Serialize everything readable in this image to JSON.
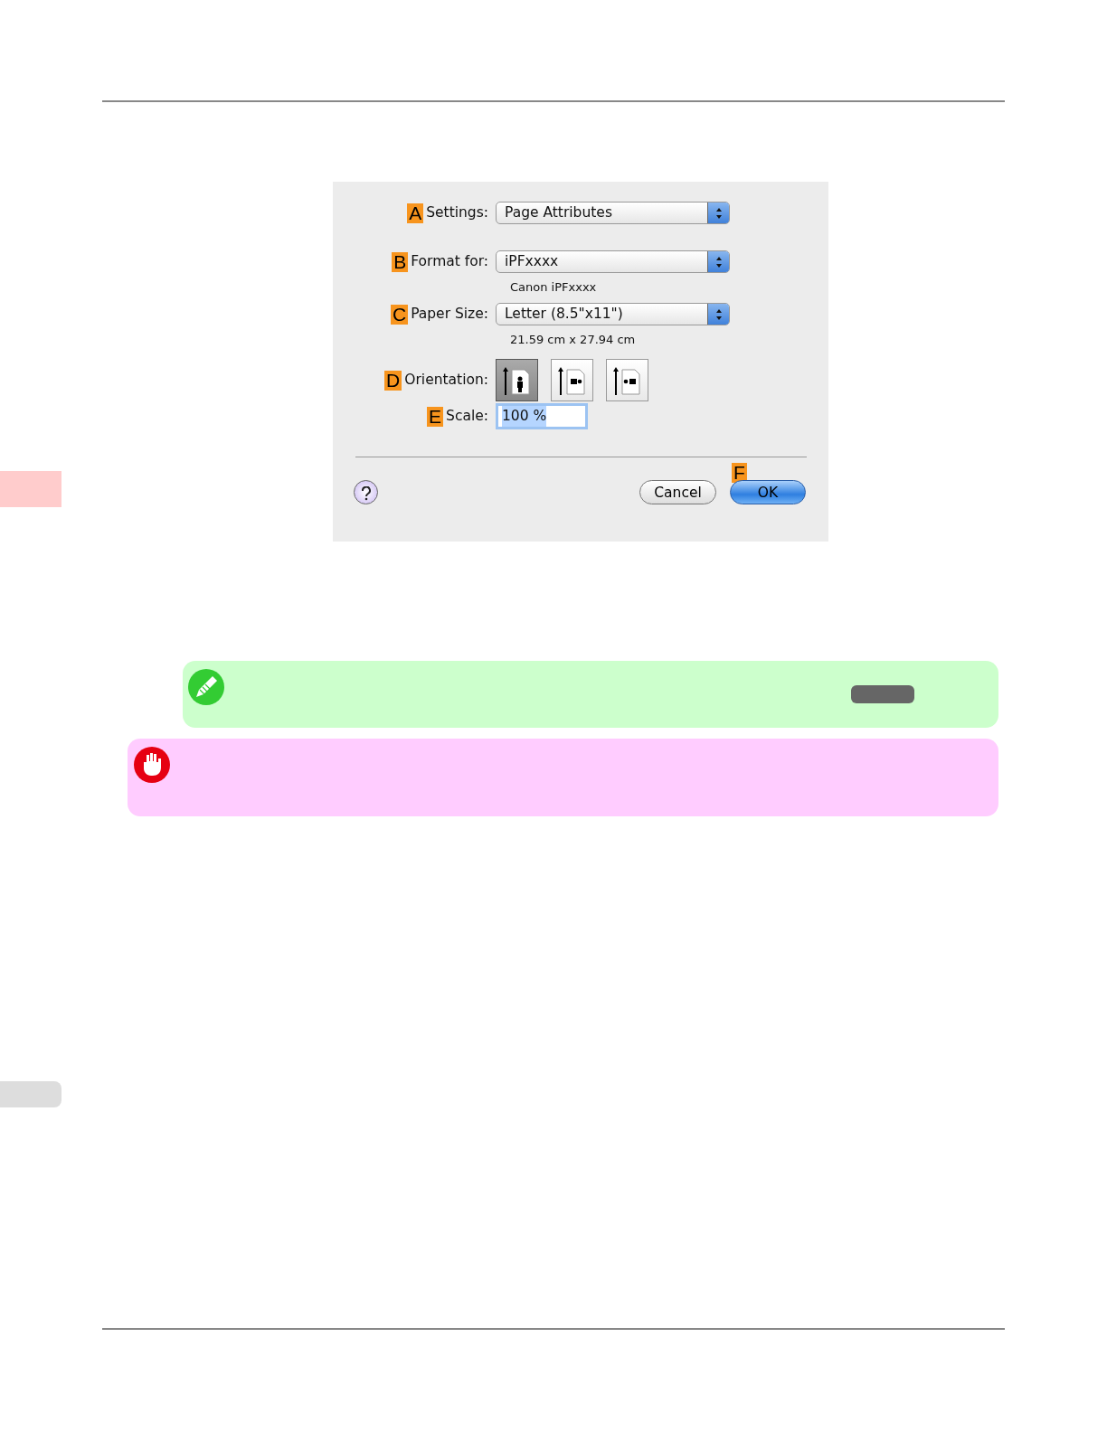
{
  "dialog": {
    "rows": [
      {
        "kind": "popup",
        "callout": "A",
        "label": "Settings:",
        "value": "Page Attributes"
      },
      {
        "kind": "popup",
        "callout": "B",
        "label": "Format for:",
        "value": "iPFxxxx",
        "note": "Canon iPFxxxx"
      },
      {
        "kind": "popup",
        "callout": "C",
        "label": "Paper Size:",
        "value": "Letter (8.5\"x11\")",
        "note": "21.59 cm x 27.94 cm"
      },
      {
        "kind": "orientation",
        "callout": "D",
        "label": "Orientation:",
        "options": [
          {
            "selected": true
          },
          {
            "selected": false
          },
          {
            "selected": false
          }
        ]
      },
      {
        "kind": "field",
        "callout": "E",
        "label": "Scale:",
        "value": "100 %",
        "highlighted": true
      }
    ],
    "buttons": [
      {
        "label": "Cancel",
        "default": false
      },
      {
        "label": "OK",
        "default": true,
        "callout": "F"
      }
    ]
  }
}
